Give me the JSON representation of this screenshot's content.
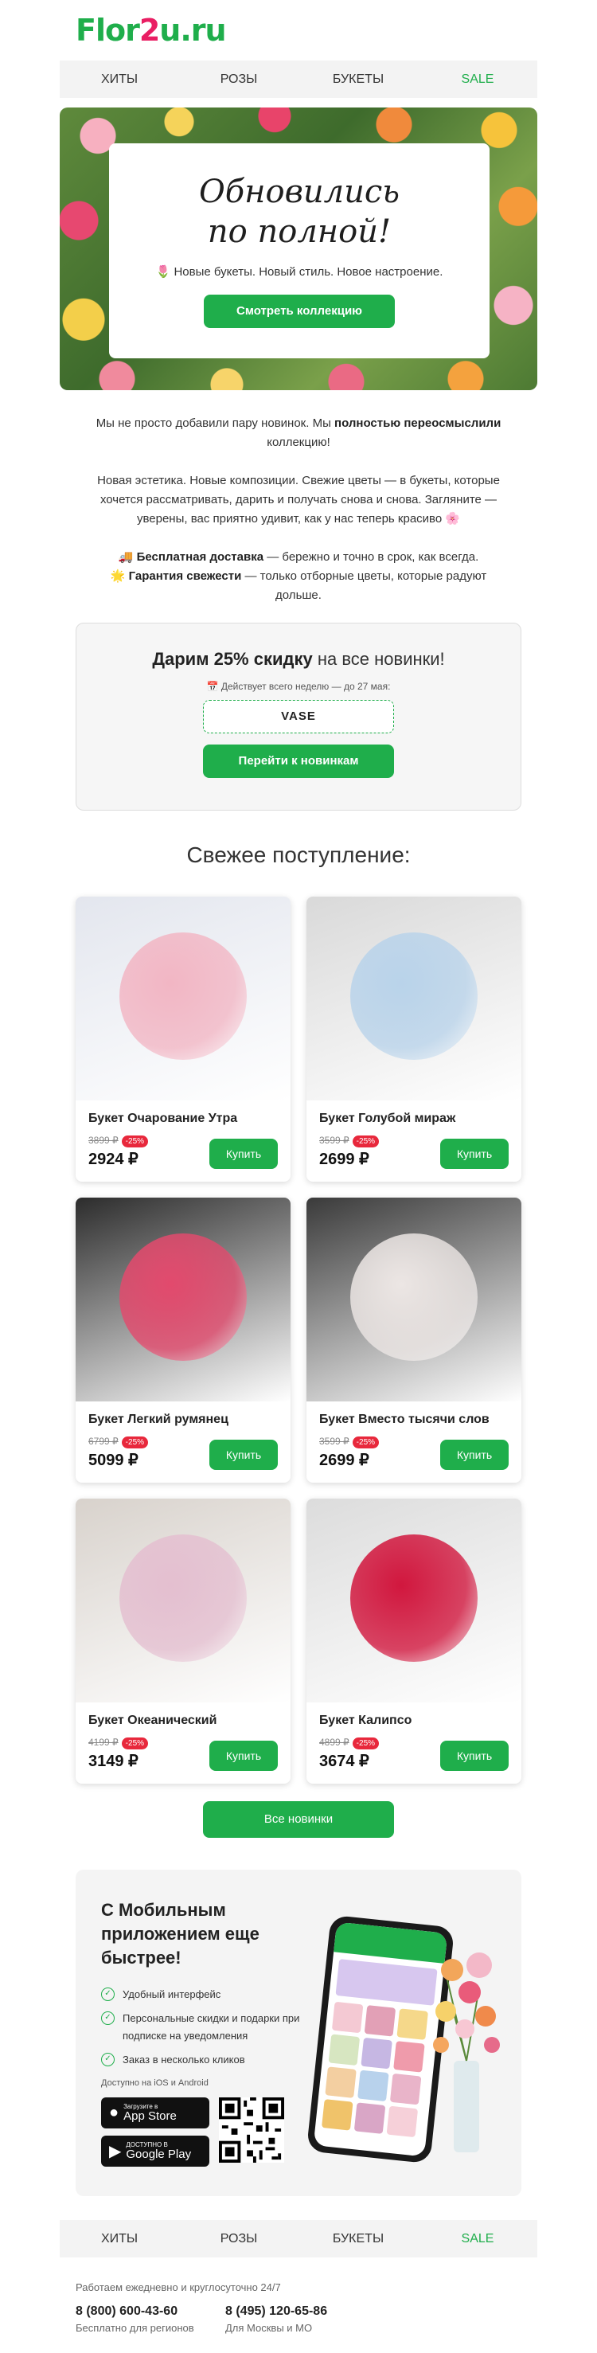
{
  "logo": {
    "part1": "Flor",
    "part2": "2",
    "part3": "u.ru"
  },
  "nav": [
    {
      "label": "ХИТЫ"
    },
    {
      "label": "РОЗЫ"
    },
    {
      "label": "БУКЕТЫ"
    },
    {
      "label": "SALE"
    }
  ],
  "hero": {
    "title": "Обновились по полной!",
    "subtitle": "🌷 Новые букеты. Новый стиль. Новое настроение.",
    "button": "Смотреть коллекцию"
  },
  "intro": {
    "p1_a": "Мы не просто добавили пару новинок. Мы ",
    "p1_b": "полностью переосмыслили",
    "p1_c": " коллекцию!",
    "p2": "Новая эстетика. Новые композиции. Свежие цветы — в букеты, которые хочется рассматривать, дарить и получать снова и снова. Загляните — уверены, вас приятно удивит, как у нас теперь красиво 🌸",
    "p3_a": "🚚 ",
    "p3_b": "Бесплатная доставка",
    "p3_c": " — бережно и точно в срок, как всегда.",
    "p4_a": "🌟 ",
    "p4_b": "Гарантия свежести",
    "p4_c": " — только отборные цветы, которые радуют дольше."
  },
  "promo": {
    "title_bold": "Дарим 25% скидку",
    "title_rest": " на все новинки!",
    "date": "📅 Действует всего неделю — до 27 мая:",
    "code": "VASE",
    "button": "Перейти к новинкам"
  },
  "section_title": "Свежее поступление:",
  "products": [
    {
      "name": "Букет Очарование Утра",
      "old_price": "3899 ₽",
      "discount": "-25%",
      "price": "2924 ₽",
      "button": "Купить",
      "bg": "#e3e6ee",
      "flower": "#f2b6c4"
    },
    {
      "name": "Букет Голубой мираж",
      "old_price": "3599 ₽",
      "discount": "-25%",
      "price": "2699 ₽",
      "button": "Купить",
      "bg": "#d9d9d9",
      "flower": "#b9d3ea"
    },
    {
      "name": "Букет Легкий румянец",
      "old_price": "6799 ₽",
      "discount": "-25%",
      "price": "5099 ₽",
      "button": "Купить",
      "bg": "#2c2c2c",
      "flower": "#e24a6d"
    },
    {
      "name": "Букет Вместо тысячи слов",
      "old_price": "3599 ₽",
      "discount": "-25%",
      "price": "2699 ₽",
      "button": "Купить",
      "bg": "#3a3a3a",
      "flower": "#ece6e4"
    },
    {
      "name": "Букет Океанический",
      "old_price": "4199 ₽",
      "discount": "-25%",
      "price": "3149 ₽",
      "button": "Купить",
      "bg": "#d8d2cc",
      "flower": "#e4bfd0"
    },
    {
      "name": "Букет Калипсо",
      "old_price": "4899 ₽",
      "discount": "-25%",
      "price": "3674 ₽",
      "button": "Купить",
      "bg": "#dcdcdc",
      "flower": "#d1173e"
    }
  ],
  "all_button": "Все новинки",
  "app": {
    "title": "С Мобильным приложением еще быстрее!",
    "features": [
      "Удобный интерфейс",
      "Персональные скидки и подарки при подписке на уведомления",
      "Заказ в несколько кликов"
    ],
    "available": "Доступно на iOS и Android",
    "appstore_small": "Загрузите в",
    "appstore_big": "App Store",
    "gplay_small": "ДОСТУПНО В",
    "gplay_big": "Google Play"
  },
  "footer": {
    "hours": "Работаем ежедневно и круглосуточно 24/7",
    "phone1": "8 (800) 600-43-60",
    "phone1_note": "Бесплатно для регионов",
    "phone2": "8 (495) 120-65-86",
    "phone2_note": "Для Москвы и МО"
  },
  "colors": {
    "accent": "#1fae4b",
    "brand_pink": "#e91e63",
    "badge": "#e8283c"
  }
}
